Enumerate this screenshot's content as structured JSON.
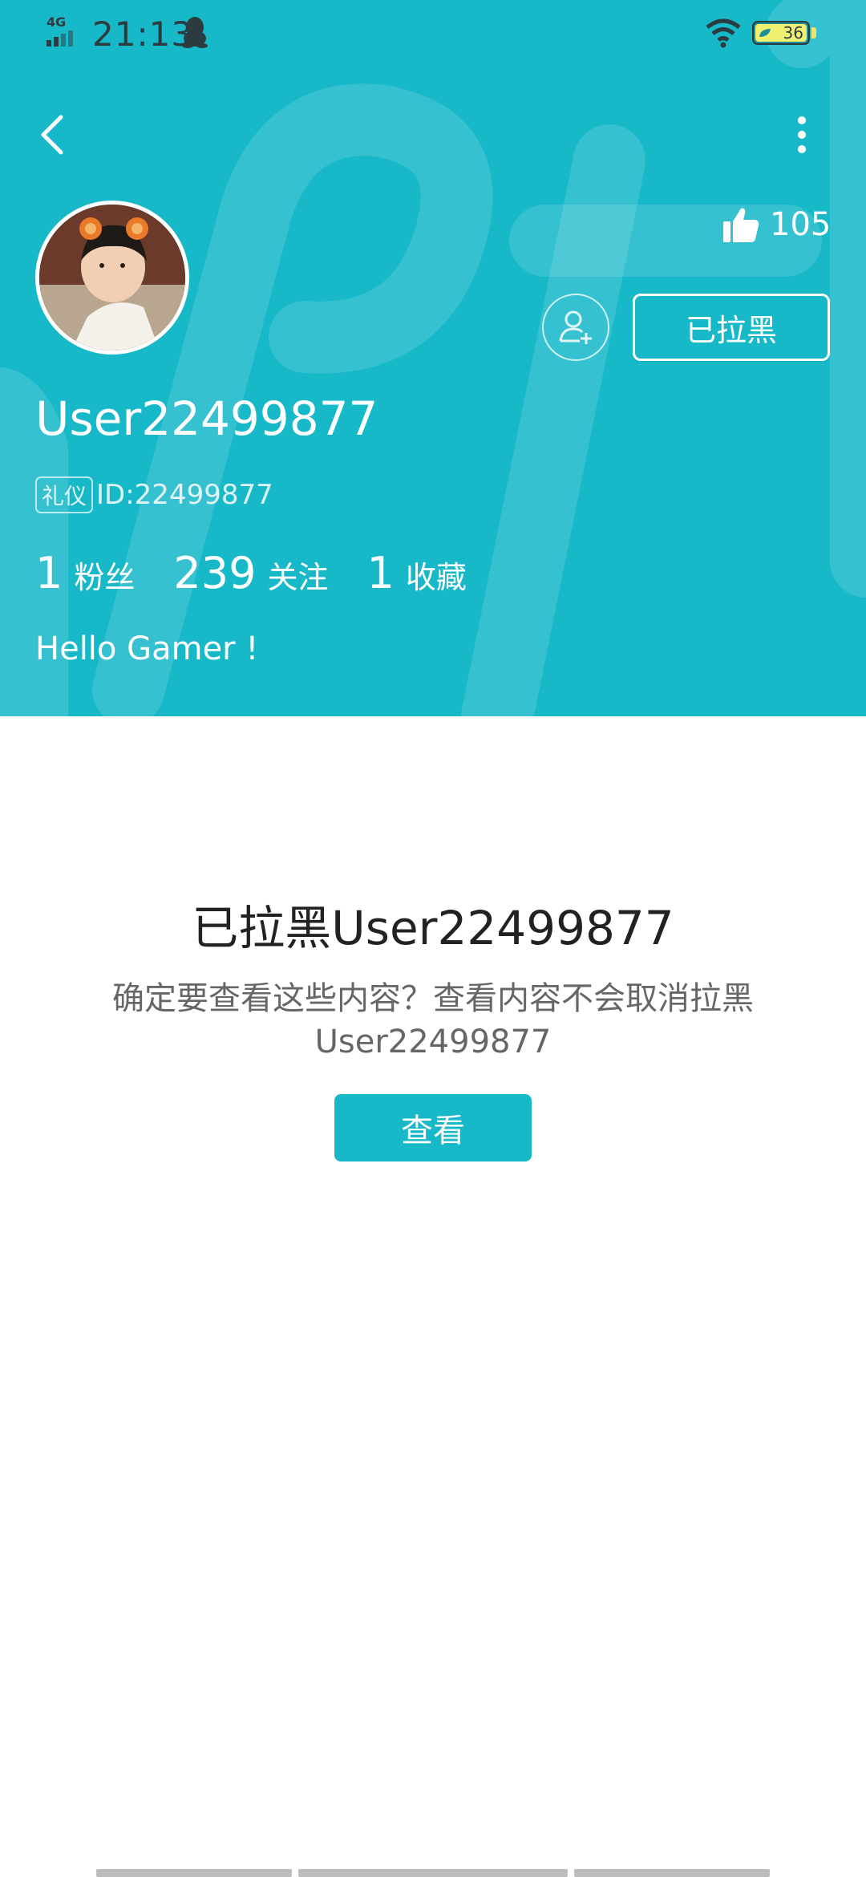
{
  "status_bar": {
    "network": "4G",
    "time": "21:13",
    "battery": 36,
    "battery_text": "36"
  },
  "profile": {
    "likes": "105",
    "blocked_label": "已拉黑",
    "username": "User22499877",
    "role_badge": "礼仪",
    "id_text": "ID:22499877",
    "stats": [
      {
        "value": "1",
        "label": "粉丝"
      },
      {
        "value": "239",
        "label": "关注"
      },
      {
        "value": "1",
        "label": "收藏"
      }
    ],
    "bio": "Hello Gamer !"
  },
  "blocked_notice": {
    "title": "已拉黑User22499877",
    "message": "确定要查看这些内容？查看内容不会取消拉黑User22499877",
    "view_button": "查看"
  },
  "colors": {
    "accent": "#17b8c8",
    "background": "#ffffff",
    "title_text": "#222222",
    "body_text": "#666666"
  }
}
